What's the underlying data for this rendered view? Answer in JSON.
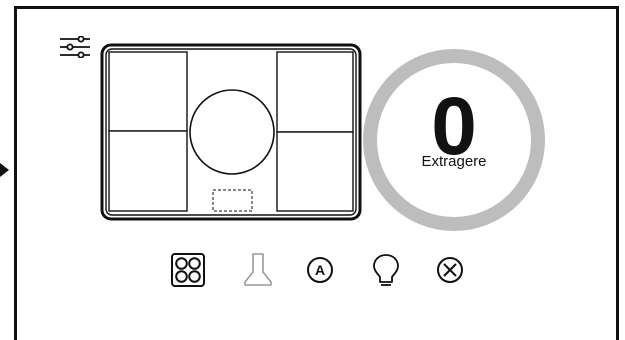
{
  "status": {
    "value": "0",
    "label": "Extragere",
    "ring_color": "#bdbdbd"
  },
  "icons": {
    "settings": "sliders-icon",
    "hob_zones": "hob-four-zones-icon",
    "hood": "hood-icon",
    "auto": "auto-mode-icon",
    "light": "light-bulb-icon",
    "close": "close-circle-icon",
    "auto_letter": "A"
  },
  "colors": {
    "foreground": "#111111",
    "hood_icon": "#999999",
    "background": "#ffffff"
  }
}
